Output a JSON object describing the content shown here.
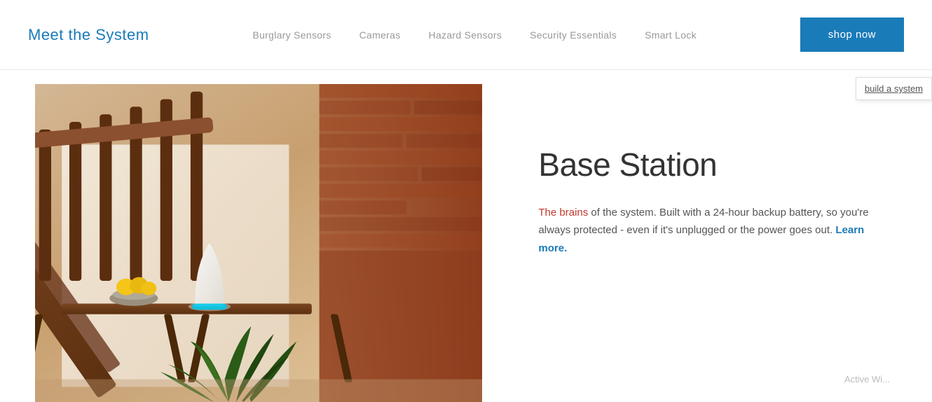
{
  "header": {
    "logo_text": "Meet the System",
    "nav_items": [
      {
        "label": "Burglary Sensors",
        "id": "burglary-sensors"
      },
      {
        "label": "Cameras",
        "id": "cameras"
      },
      {
        "label": "Hazard Sensors",
        "id": "hazard-sensors"
      },
      {
        "label": "Security Essentials",
        "id": "security-essentials"
      },
      {
        "label": "Smart Lock",
        "id": "smart-lock"
      }
    ],
    "shop_now_label": "shop now"
  },
  "sidebar": {
    "build_system_label": "build a system"
  },
  "main": {
    "product_title": "Base Station",
    "description_part1": "The brains",
    "description_part2": " of the system. Built with a 24-hour backup battery, so you're always protected - even if it's unplugged or the power goes out. ",
    "description_link": "Learn more.",
    "bottom_hint": "Active Wi..."
  }
}
